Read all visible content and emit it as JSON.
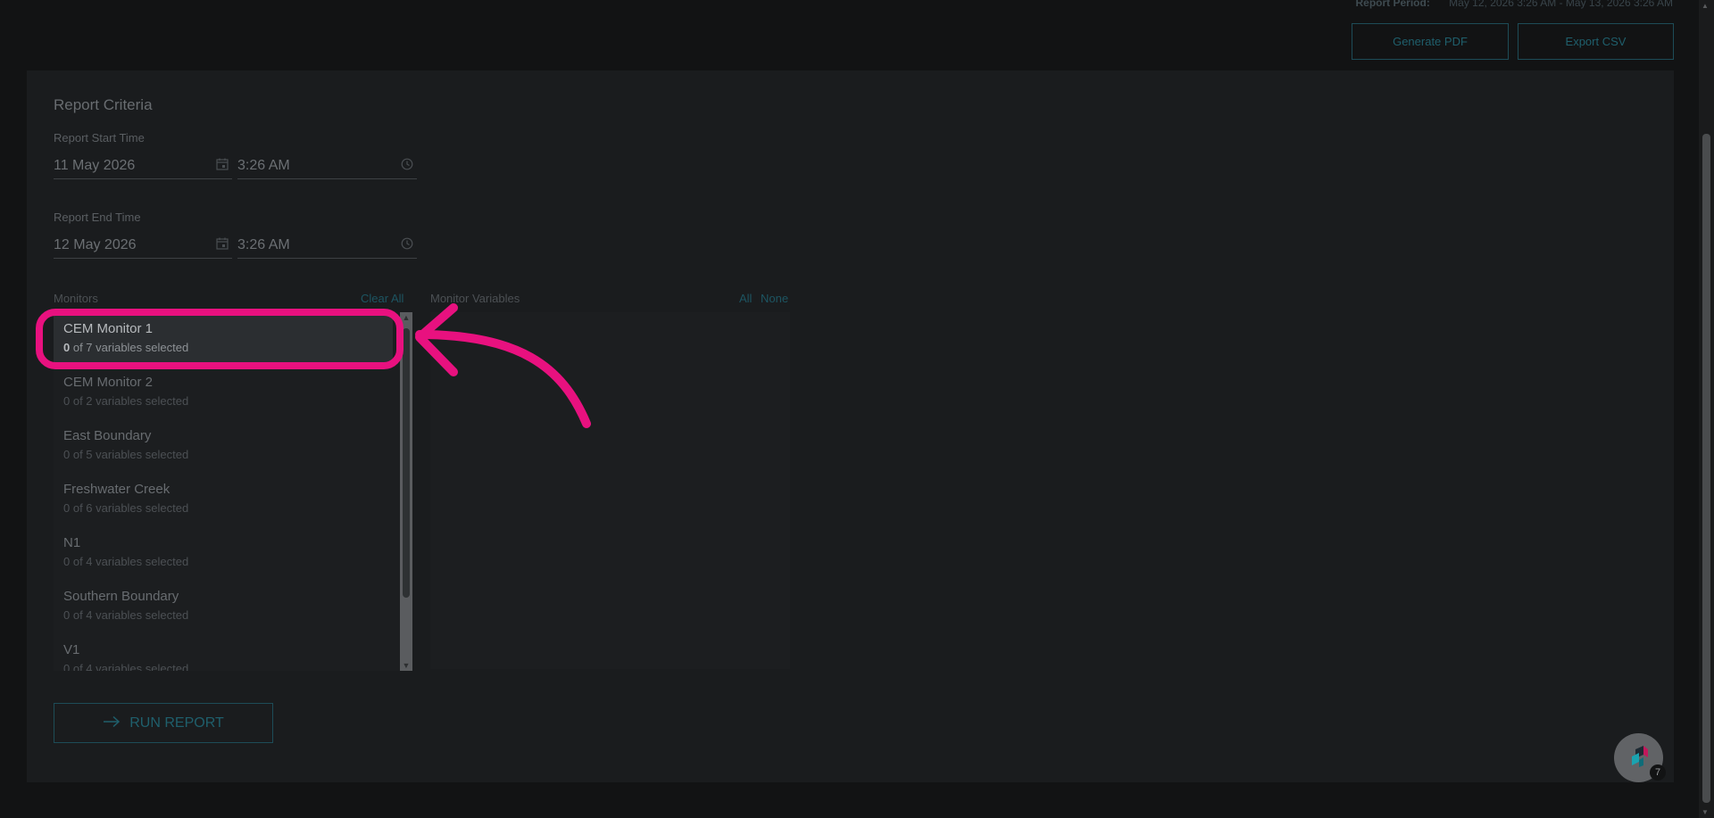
{
  "header": {
    "report_period_label": "Report Period:",
    "report_period_value": "May 12, 2026 3:26 AM - May 13, 2026 3:26 AM",
    "generate_pdf_label": "Generate PDF",
    "export_csv_label": "Export CSV"
  },
  "criteria": {
    "title": "Report Criteria",
    "start_label": "Report Start Time",
    "start_date": "11 May 2026",
    "start_time": "3:26 AM",
    "end_label": "Report End Time",
    "end_date": "12 May 2026",
    "end_time": "3:26 AM"
  },
  "monitors": {
    "label": "Monitors",
    "clear_all_label": "Clear All",
    "items": [
      {
        "name": "CEM Monitor 1",
        "selected_count": "0",
        "subtitle_rest": " of 7 variables selected",
        "subtitle": "0 of 7 variables selected"
      },
      {
        "name": "CEM Monitor 2",
        "subtitle": "0 of 2 variables selected"
      },
      {
        "name": "East Boundary",
        "subtitle": "0 of 5 variables selected"
      },
      {
        "name": "Freshwater Creek",
        "subtitle": "0 of 6 variables selected"
      },
      {
        "name": "N1",
        "subtitle": "0 of 4 variables selected"
      },
      {
        "name": "Southern Boundary",
        "subtitle": "0 of 4 variables selected"
      },
      {
        "name": "V1",
        "subtitle": "0 of 4 variables selected"
      }
    ]
  },
  "variables": {
    "label": "Monitor Variables",
    "all_label": "All",
    "none_label": "None"
  },
  "run_report_label": "RUN REPORT",
  "help_badge_count": "7",
  "colors": {
    "accent": "#1f5f6c",
    "highlight": "#e8117f",
    "background": "#121314",
    "panel": "#1a1c1e"
  },
  "icons": [
    "calendar-icon",
    "clock-icon",
    "arrow-right-icon",
    "scroll-up-icon",
    "scroll-down-icon",
    "help-logo-icon"
  ]
}
